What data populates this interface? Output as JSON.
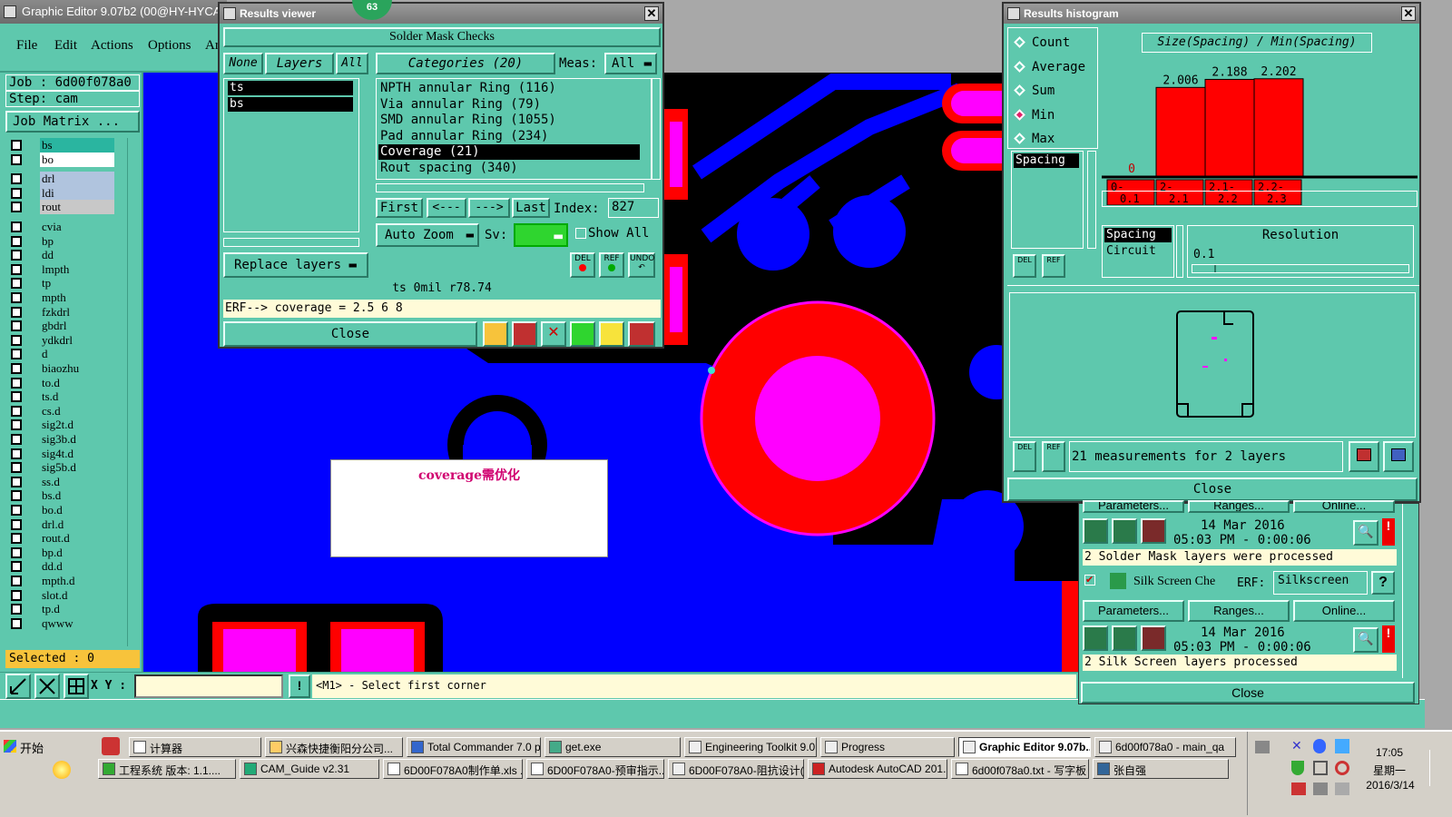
{
  "editor": {
    "title": "Graphic Editor 9.07b2 (00@HY-HYCAM-",
    "menu": [
      "File",
      "Edit",
      "Actions",
      "Options",
      "Ar"
    ],
    "job": "Job : 6d00f078a0",
    "step": "Step: cam",
    "job_matrix": "Job Matrix ...",
    "layers": [
      "bs",
      "bo",
      "drl",
      "ldi",
      "rout",
      "cvia",
      "bp",
      "dd",
      "lmpth",
      "tp",
      "mpth",
      "fzkdrl",
      "gbdrl",
      "ydkdrl",
      "d",
      "biaozhu",
      "to.d",
      "ts.d",
      "cs.d",
      "sig2t.d",
      "sig3b.d",
      "sig4t.d",
      "sig5b.d",
      "ss.d",
      "bs.d",
      "bo.d",
      "drl.d",
      "rout.d",
      "bp.d",
      "dd.d",
      "mpth.d",
      "slot.d",
      "tp.d",
      "qwww"
    ],
    "selected": "Selected : 0",
    "xy_label": "X Y :",
    "xy_value": "",
    "prompt": "<M1> - Select first corner",
    "annotation": "coverage需优化"
  },
  "results_viewer": {
    "title": "Results viewer",
    "badge": "63",
    "heading": "Solder Mask Checks",
    "tabs": [
      "None",
      "Layers",
      "All"
    ],
    "layers": [
      "ts",
      "bs"
    ],
    "categories_label": "Categories (20)",
    "meas_label": "Meas:",
    "meas_value": "All",
    "categories": [
      "NPTH annular Ring (116)",
      "Via annular Ring (79)",
      "SMD annular Ring (1055)",
      "Pad annular Ring (234)",
      "Coverage (21)",
      "Rout spacing (340)"
    ],
    "selected_category": 4,
    "nav": [
      "First",
      "<---",
      "--->",
      "Last"
    ],
    "index_label": "Index:",
    "index_value": "827",
    "auto_zoom": "Auto Zoom",
    "sv_label": "Sv:",
    "show_all": "Show All",
    "replace_layers": "Replace layers",
    "tool_labels": [
      "DEL",
      "REF",
      "UNDO"
    ],
    "info": "ts 0mil   r78.74",
    "erf": "ERF--> coverage = 2.5 6 8",
    "close": "Close"
  },
  "histogram": {
    "title": "Results histogram",
    "options": [
      "Count",
      "Average",
      "Sum",
      "Min",
      "Max"
    ],
    "selected_option": "Min",
    "chart_title": "Size(Spacing) / Min(Spacing)",
    "list_items": [
      "Spacing"
    ],
    "param_items": [
      "Spacing",
      "Circuit"
    ],
    "resolution_label": "Resolution",
    "resolution_value": "0.1",
    "measurements": "21 measurements for 2 layers",
    "close": "Close",
    "tool_labels": [
      "DEL",
      "REF"
    ]
  },
  "chart_data": {
    "type": "bar",
    "title": "Size(Spacing) / Min(Spacing)",
    "categories": [
      "0-\n0.1",
      "2-\n2.1",
      "2.1-\n2.2",
      "2.2-\n2.3"
    ],
    "values": [
      0,
      2.006,
      2.188,
      2.202
    ],
    "value_labels": [
      "0",
      "2.006",
      "2.188",
      "2.202"
    ],
    "ylim": [
      0,
      2.3
    ],
    "bar_color": "#ff0000"
  },
  "qa": {
    "header_buttons": [
      "Parameters...",
      "Ranges...",
      "Online..."
    ],
    "date1": "14 Mar 2016",
    "time1": "05:03 PM - 0:00:06",
    "msg1": "2 Solder Mask layers were processed",
    "silk_label": "Silk Screen Che",
    "erf_label": "ERF:",
    "erf_value": "Silkscreen",
    "help": "?",
    "buttons": [
      "Parameters...",
      "Ranges...",
      "Online..."
    ],
    "date2": "14 Mar 2016",
    "time2": "05:03 PM - 0:00:06",
    "msg2": "2 Silk Screen layers processed",
    "close": "Close"
  },
  "taskbar": {
    "start": "开始",
    "row1": [
      "计算器",
      "兴森快捷衡阳分公司...",
      "Total Commander 7.0 p...",
      "get.exe",
      "Engineering Toolkit 9.0...",
      "Progress",
      "Graphic Editor 9.07b...",
      "6d00f078a0 - main_qa"
    ],
    "row2": [
      "工程系统  版本: 1.1....",
      "CAM_Guide v2.31",
      "6D00F078A0制作单.xls ...",
      "6D00F078A0-预审指示....",
      "6D00F078A0-阻抗设计(...",
      "Autodesk AutoCAD 201...",
      "6d00f078a0.txt - 写字板",
      "张自强"
    ],
    "time": "17:05",
    "weekday": "星期一",
    "date": "2016/3/14"
  },
  "colors": {
    "panel": "#5ec8ad",
    "canvas": "#0000ff",
    "pad": "#ff0000",
    "mask": "#ff00ff"
  }
}
